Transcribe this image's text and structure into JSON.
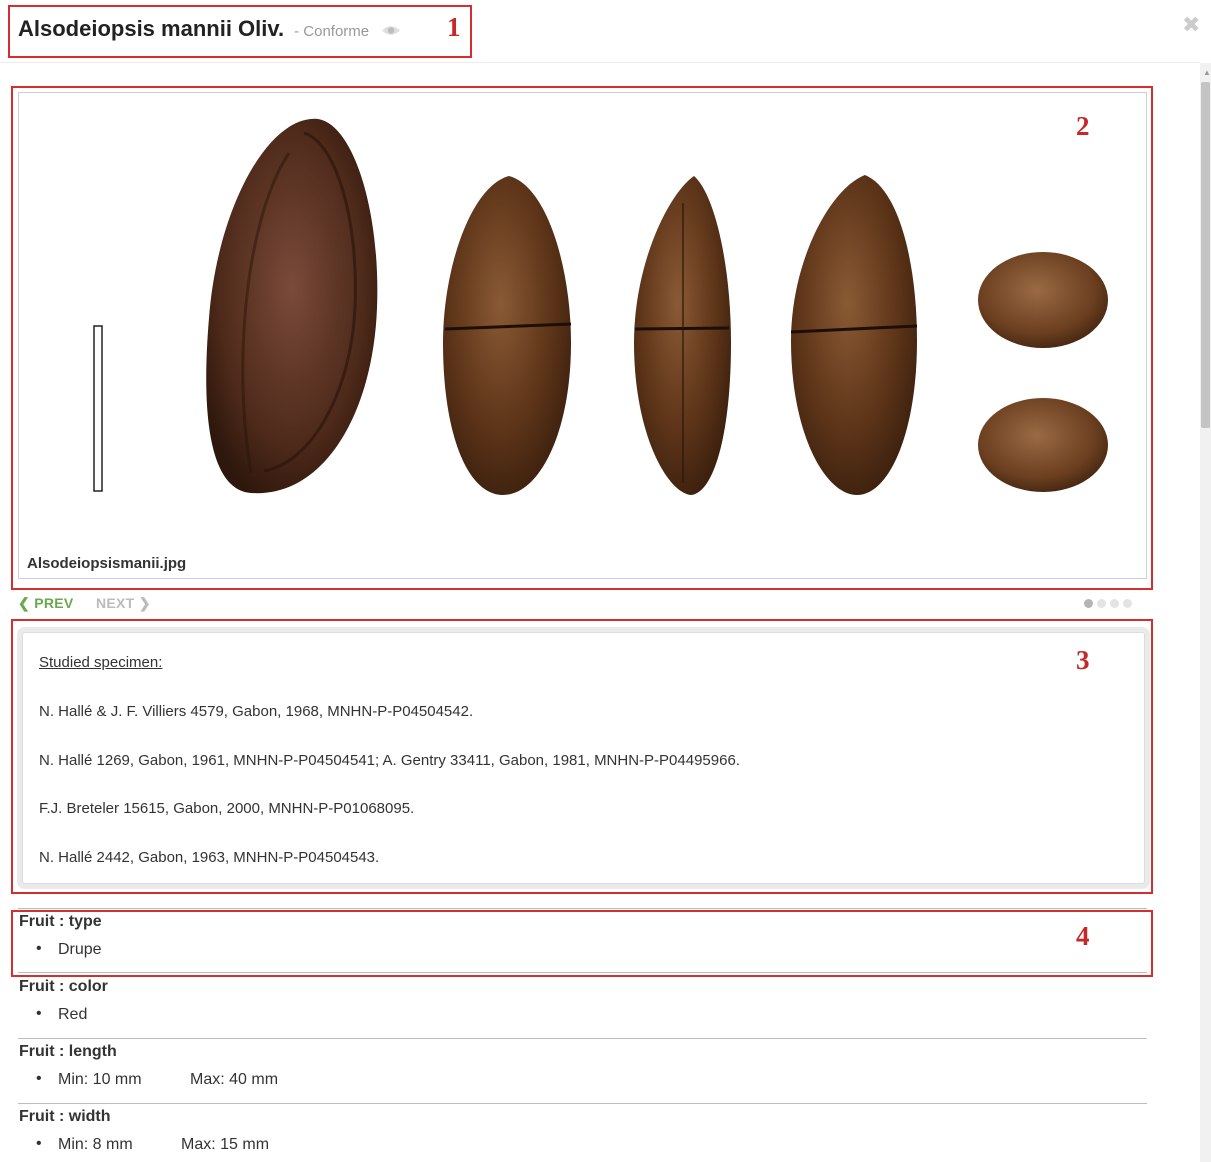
{
  "header": {
    "title": "Alsodeiopsis mannii Oliv.",
    "status": "- Conforme",
    "close_glyph": "✖"
  },
  "annotations": [
    "1",
    "2",
    "3",
    "4"
  ],
  "gallery": {
    "filename": "Alsodeiopsismanii.jpg",
    "prev_label": "PREV",
    "next_label": "NEXT",
    "prev_arrow": "❮",
    "next_arrow": "❯",
    "dot_count": 4,
    "active_dot": 0
  },
  "specimens": {
    "heading": "Studied specimen:",
    "references": [
      "N. Hallé & J. F. Villiers 4579, Gabon, 1968, MNHN-P-P04504542.",
      "N. Hallé 1269, Gabon, 1961, MNHN-P-P04504541; A. Gentry 33411, Gabon, 1981, MNHN-P-P04495966.",
      "F.J. Breteler 15615, Gabon, 2000, MNHN-P-P01068095.",
      "N. Hallé 2442, Gabon, 1963, MNHN-P-P04504543."
    ]
  },
  "attributes": [
    {
      "title": "Fruit : type",
      "values": [
        "Drupe"
      ]
    },
    {
      "title": "Fruit : color",
      "values": [
        "Red"
      ]
    },
    {
      "title": "Fruit : length",
      "values": [
        "Min: 10 mm",
        "Max: 40 mm"
      ]
    },
    {
      "title": "Fruit : width",
      "values": [
        "Min: 8 mm",
        "Max: 15 mm"
      ]
    }
  ],
  "icons": {
    "eye": "eye-icon",
    "close": "close-icon",
    "prev": "chevron-left-icon",
    "next": "chevron-right-icon"
  },
  "colors": {
    "annotation": "#d32f2f",
    "prev_active": "#6aa84f",
    "next_disabled": "#bbbbbb",
    "seed_brown": "#5a3418"
  }
}
